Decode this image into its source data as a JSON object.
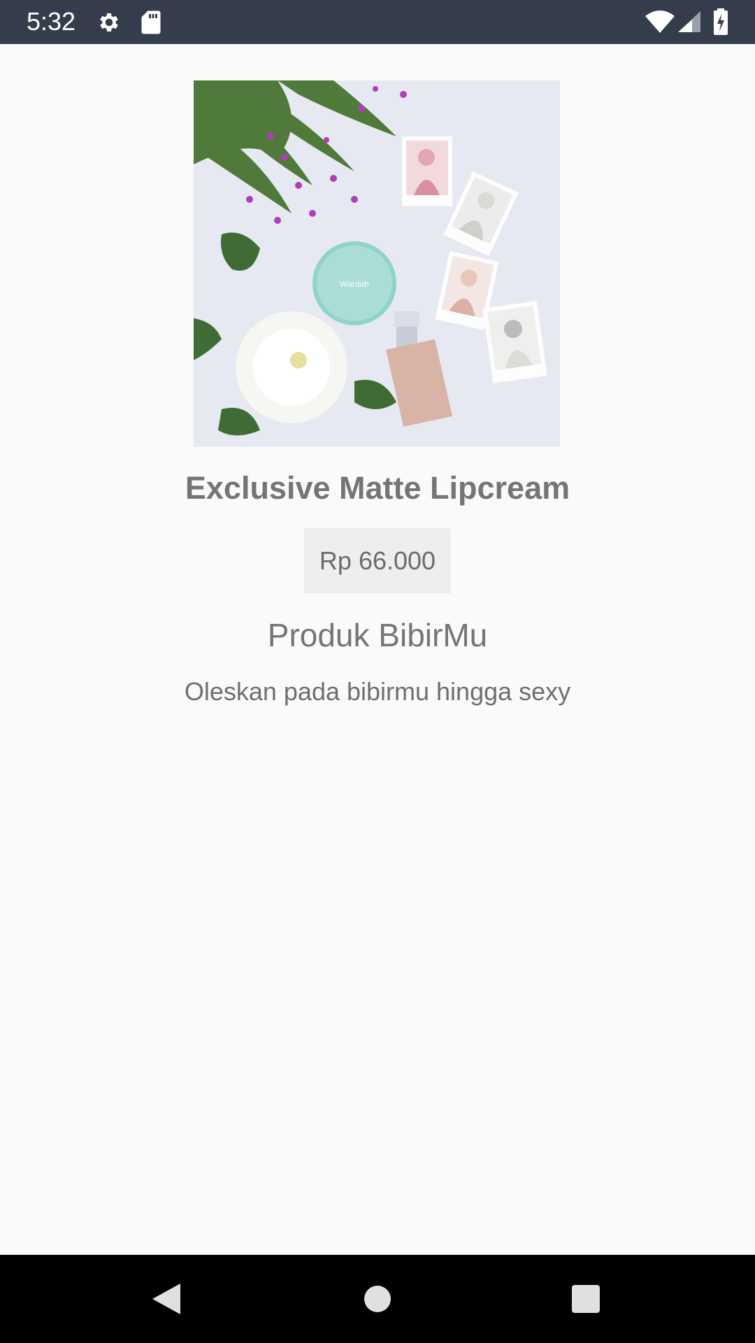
{
  "status_bar": {
    "time": "5:32",
    "icons": [
      "gear-icon",
      "sd-card-icon",
      "wifi-icon",
      "cell-signal-icon",
      "battery-charging-icon"
    ],
    "background": "#353d4c"
  },
  "product": {
    "image_alt": "Wardah product photo",
    "image_brand_text": "Wardah",
    "title": "Exclusive Matte Lipcream",
    "price": "Rp 66.000",
    "category": "Produk BibirMu",
    "description": "Oleskan pada bibirmu hingga sexy"
  },
  "nav_bar": {
    "buttons": [
      "back-icon",
      "home-icon",
      "recents-icon"
    ]
  },
  "colors": {
    "background": "#fafafa",
    "text_primary": "#757575",
    "price_chip": "#eeeeee"
  }
}
